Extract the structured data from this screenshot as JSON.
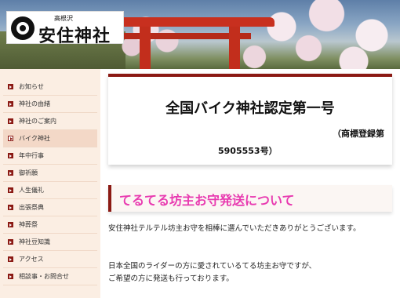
{
  "header": {
    "logo_sub": "高根沢",
    "logo_title": "安住神社"
  },
  "sidebar": {
    "items": [
      {
        "label": "お知らせ",
        "active": false
      },
      {
        "label": "神社の由緒",
        "active": false
      },
      {
        "label": "神社のご案内",
        "active": false
      },
      {
        "label": "バイク神社",
        "active": true
      },
      {
        "label": "年中行事",
        "active": false
      },
      {
        "label": "御祈願",
        "active": false
      },
      {
        "label": "人生儀礼",
        "active": false
      },
      {
        "label": "出張祭典",
        "active": false
      },
      {
        "label": "神葬祭",
        "active": false
      },
      {
        "label": "神社豆知識",
        "active": false
      },
      {
        "label": "アクセス",
        "active": false
      },
      {
        "label": "相談事・お問合せ",
        "active": false
      }
    ]
  },
  "main": {
    "title": "全国バイク神社認定第一号",
    "trademark_line1": "（商標登録第",
    "trademark_line2": "5905553号）",
    "section_heading": "てるてる坊主お守発送について",
    "paragraph1": "安住神社テルテル坊主お守を相棒に選んでいただきありがとうございます。",
    "paragraph2": "日本全国のライダーの方に愛されているてる坊主お守ですが、",
    "paragraph3": "ご希望の方に発送も行っております。"
  },
  "colors": {
    "accent": "#8b1a14",
    "heading_pink": "#e83ab0",
    "sidebar_bg": "#fbeee3"
  }
}
